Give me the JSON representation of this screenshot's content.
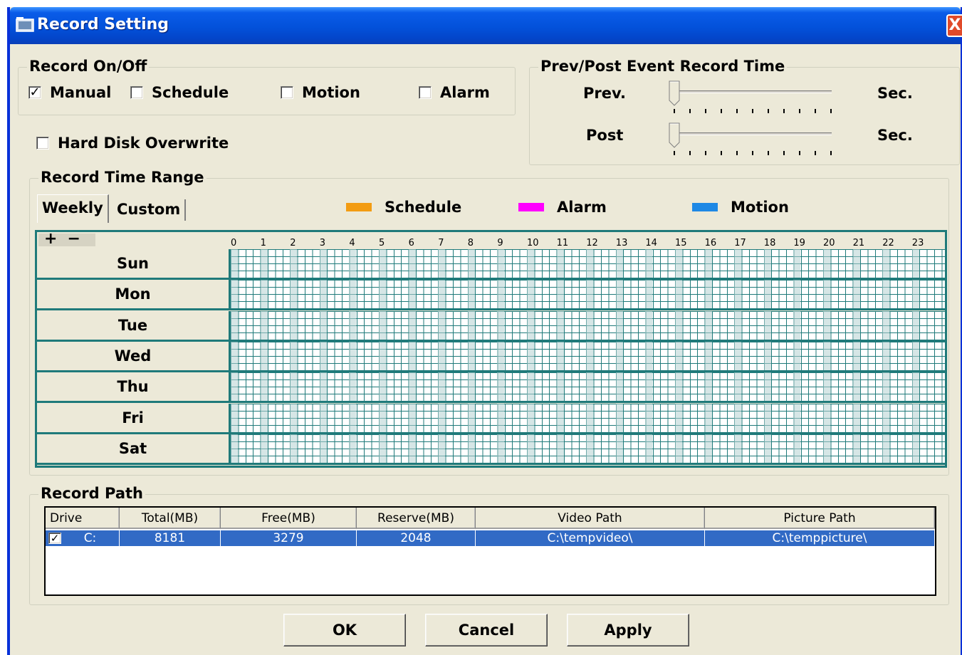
{
  "window": {
    "title": "Record Setting",
    "close_label": "X"
  },
  "record_onoff": {
    "title": "Record On/Off",
    "manual": {
      "label": "Manual",
      "checked": true
    },
    "schedule": {
      "label": "Schedule",
      "checked": false
    },
    "motion": {
      "label": "Motion",
      "checked": false
    },
    "alarm": {
      "label": "Alarm",
      "checked": false
    }
  },
  "hard_disk_overwrite": {
    "label": "Hard Disk Overwrite",
    "checked": false
  },
  "prev_post": {
    "title": "Prev/Post Event Record Time",
    "prev_label": "Prev.",
    "post_label": "Post",
    "unit": "Sec.",
    "prev_value": 0,
    "post_value": 0
  },
  "time_range": {
    "title": "Record Time Range",
    "tabs": [
      "Weekly",
      "Custom"
    ],
    "legend": [
      {
        "label": "Schedule",
        "color": "#f39c12"
      },
      {
        "label": "Alarm",
        "color": "#ff00ff"
      },
      {
        "label": "Motion",
        "color": "#1e88e5"
      }
    ],
    "plus": "+",
    "minus": "−",
    "hours": [
      "0",
      "1",
      "2",
      "3",
      "4",
      "5",
      "6",
      "7",
      "8",
      "9",
      "10",
      "11",
      "12",
      "13",
      "14",
      "15",
      "16",
      "17",
      "18",
      "19",
      "20",
      "21",
      "22",
      "23"
    ],
    "days": [
      "Sun",
      "Mon",
      "Tue",
      "Wed",
      "Thu",
      "Fri",
      "Sat"
    ]
  },
  "record_path": {
    "title": "Record Path",
    "columns": [
      "Drive",
      "Total(MB)",
      "Free(MB)",
      "Reserve(MB)",
      "Video Path",
      "Picture Path"
    ],
    "rows": [
      {
        "checked": true,
        "drive": "C:",
        "total": "8181",
        "free": "3279",
        "reserve": "2048",
        "video": "C:\\tempvideo\\",
        "picture": "C:\\temppicture\\"
      }
    ]
  },
  "buttons": {
    "ok": "OK",
    "cancel": "Cancel",
    "apply": "Apply"
  }
}
